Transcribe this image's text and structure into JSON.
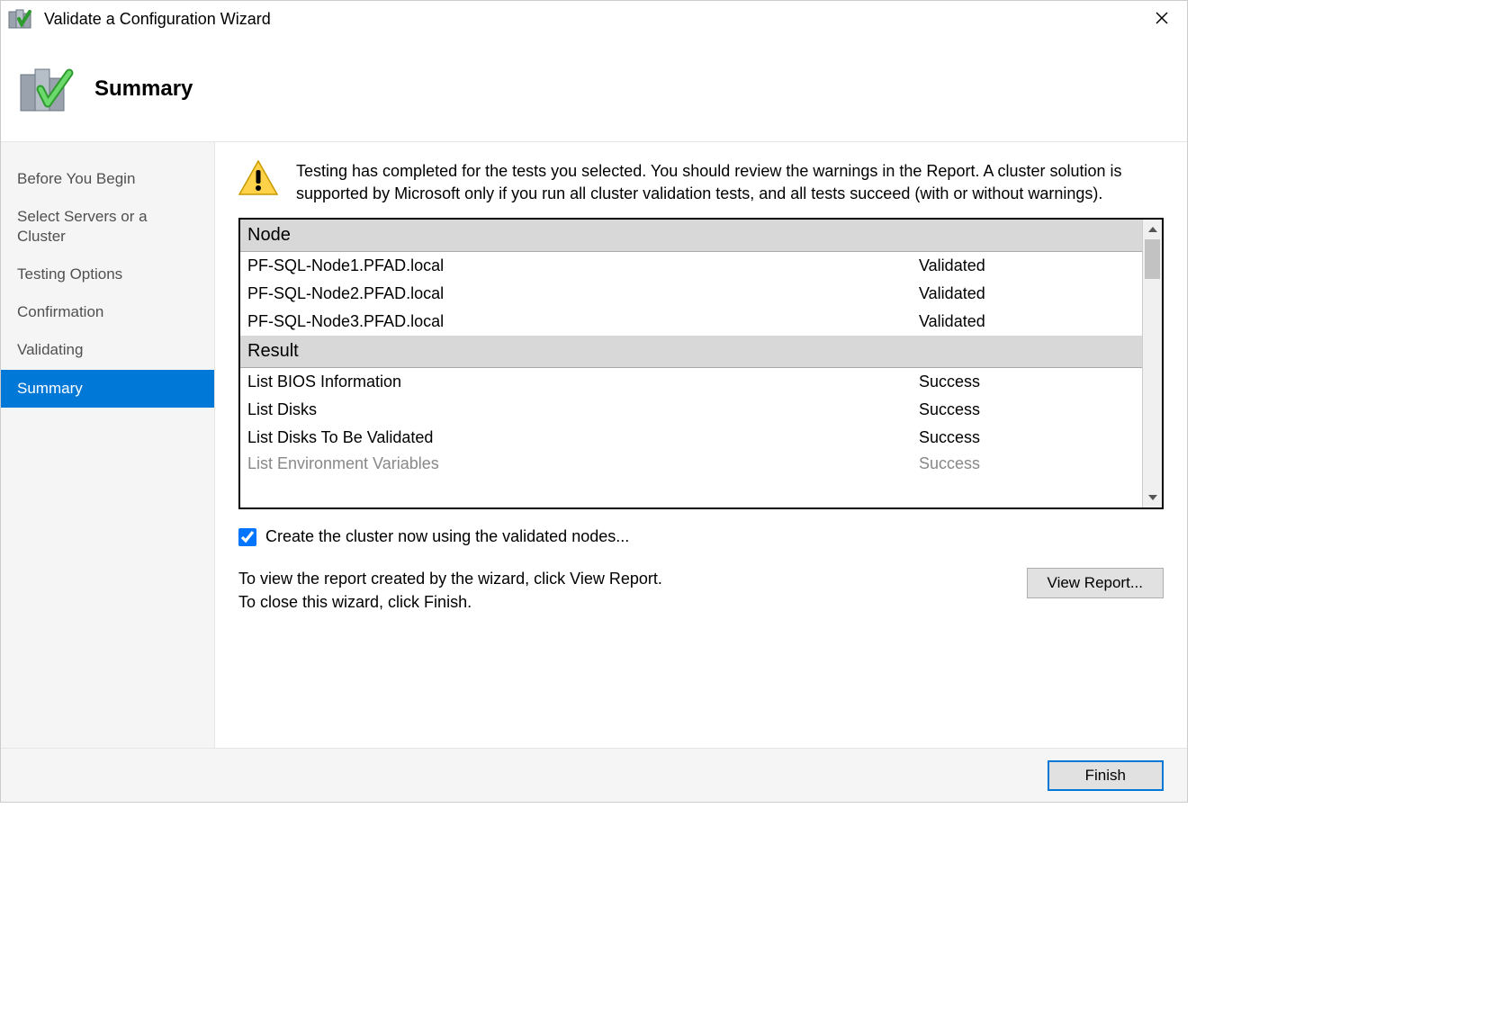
{
  "titlebar": {
    "title": "Validate a Configuration Wizard"
  },
  "header": {
    "title": "Summary"
  },
  "sidebar": {
    "items": [
      {
        "label": "Before You Begin",
        "active": false
      },
      {
        "label": "Select Servers or a Cluster",
        "active": false
      },
      {
        "label": "Testing Options",
        "active": false
      },
      {
        "label": "Confirmation",
        "active": false
      },
      {
        "label": "Validating",
        "active": false
      },
      {
        "label": "Summary",
        "active": true
      }
    ]
  },
  "main": {
    "info_text": "Testing has completed for the tests you selected. You should review the warnings in the Report.  A cluster solution is supported by Microsoft only if you run all cluster validation tests, and all tests succeed (with or without warnings).",
    "sections": {
      "node_header": "Node",
      "nodes": [
        {
          "name": "PF-SQL-Node1.PFAD.local",
          "status": "Validated"
        },
        {
          "name": "PF-SQL-Node2.PFAD.local",
          "status": "Validated"
        },
        {
          "name": "PF-SQL-Node3.PFAD.local",
          "status": "Validated"
        }
      ],
      "result_header": "Result",
      "results": [
        {
          "name": "List BIOS Information",
          "status": "Success"
        },
        {
          "name": "List Disks",
          "status": "Success"
        },
        {
          "name": "List Disks To Be Validated",
          "status": "Success"
        }
      ],
      "partial_row": {
        "name": "List Environment Variables",
        "status": "Success"
      }
    },
    "checkbox_label": "Create the cluster now using the validated nodes...",
    "checkbox_checked": true,
    "help_line1": "To view the report created by the wizard, click View Report.",
    "help_line2": "To close this wizard, click Finish.",
    "view_report_label": "View Report..."
  },
  "footer": {
    "finish_label": "Finish"
  }
}
